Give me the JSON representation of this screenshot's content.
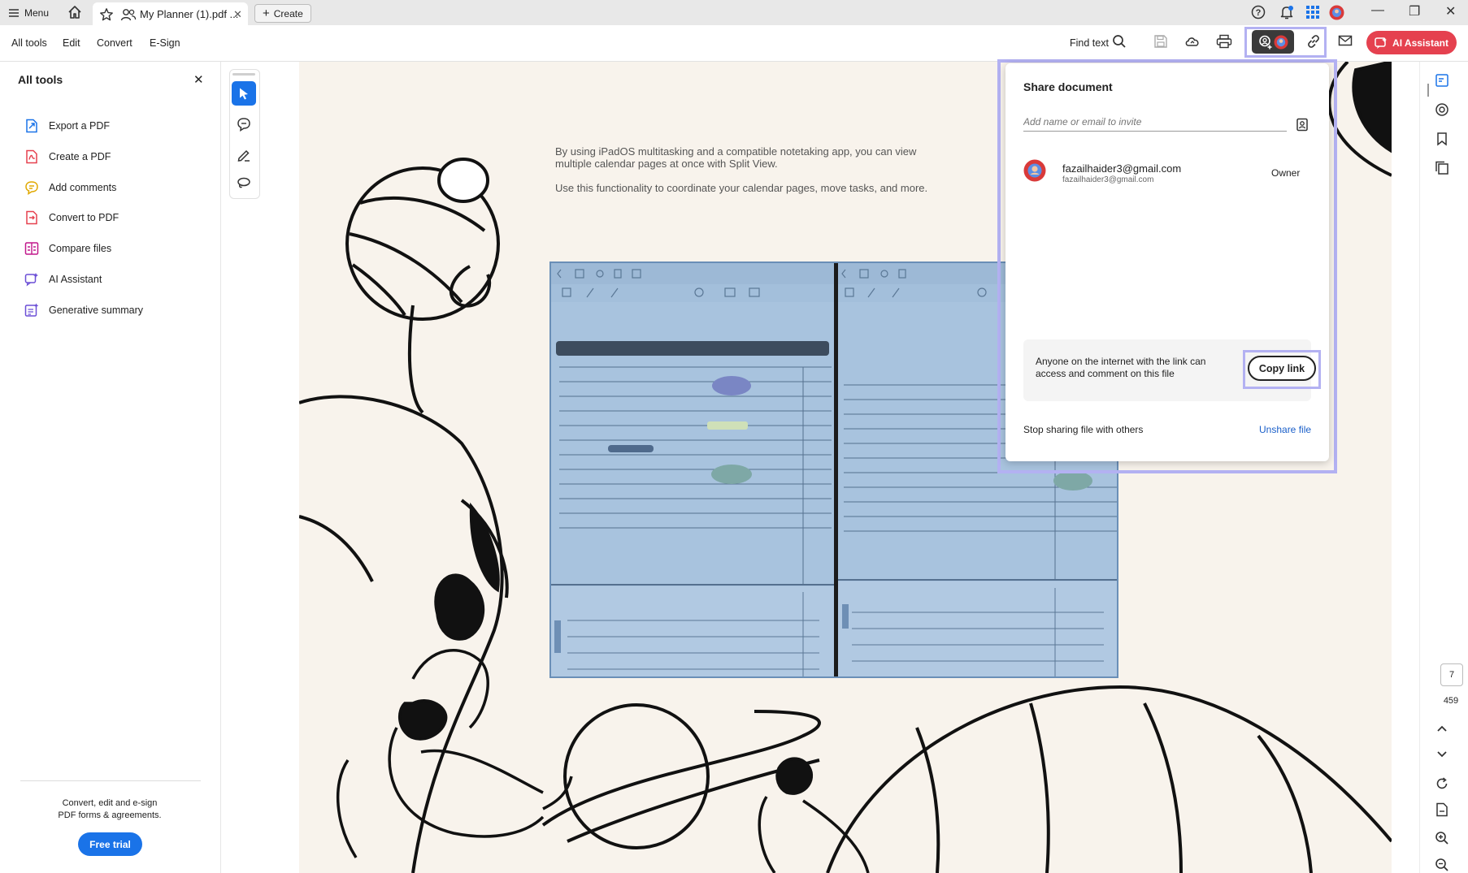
{
  "titlebar": {
    "menu_label": "Menu",
    "tab_title": "My Planner (1).pdf ...",
    "tab_close": "✕",
    "create_label": "Create",
    "window_minimize": "—",
    "window_restore": "❐",
    "window_close": "✕"
  },
  "toolbar": {
    "tabs": [
      "All tools",
      "Edit",
      "Convert",
      "E-Sign"
    ],
    "find_text": "Find text",
    "ai_assistant_label": "AI Assistant"
  },
  "left_panel": {
    "title": "All tools",
    "close": "✕",
    "items": [
      {
        "label": "Export a PDF",
        "icon": "export-pdf-icon",
        "color": "#1a73e8"
      },
      {
        "label": "Create a PDF",
        "icon": "create-pdf-icon",
        "color": "#e5414f"
      },
      {
        "label": "Add comments",
        "icon": "add-comments-icon",
        "color": "#e0a800"
      },
      {
        "label": "Convert to PDF",
        "icon": "convert-pdf-icon",
        "color": "#e5414f"
      },
      {
        "label": "Compare files",
        "icon": "compare-files-icon",
        "color": "#c2188c"
      },
      {
        "label": "AI Assistant",
        "icon": "ai-assistant-icon",
        "color": "#6b4fd6"
      },
      {
        "label": "Generative summary",
        "icon": "generative-summary-icon",
        "color": "#6b4fd6"
      }
    ],
    "promo_line1": "Convert, edit and e-sign",
    "promo_line2": "PDF forms & agreements.",
    "free_trial": "Free trial"
  },
  "document": {
    "para1": "By using iPadOS multitasking and a compatible notetaking app, you can view multiple calendar pages at once with Split View.",
    "para2": "Use this functionality to coordinate your calendar pages, move tasks, and more."
  },
  "share": {
    "title": "Share document",
    "invite_placeholder": "Add name or email to invite",
    "user_name": "fazailhaider3@gmail.com",
    "user_email": "fazailhaider3@gmail.com",
    "user_role": "Owner",
    "link_text": "Anyone on the internet with the link can access and comment on this file",
    "copy_link": "Copy link",
    "stop_sharing": "Stop sharing file with others",
    "unshare": "Unshare file"
  },
  "pagination": {
    "current_page": "7",
    "total_pages": "459"
  },
  "colors": {
    "accent": "#1a73e8",
    "ai_red": "#e5414f",
    "highlight": "#b3b1f2",
    "page_bg": "#f8f3ec"
  }
}
